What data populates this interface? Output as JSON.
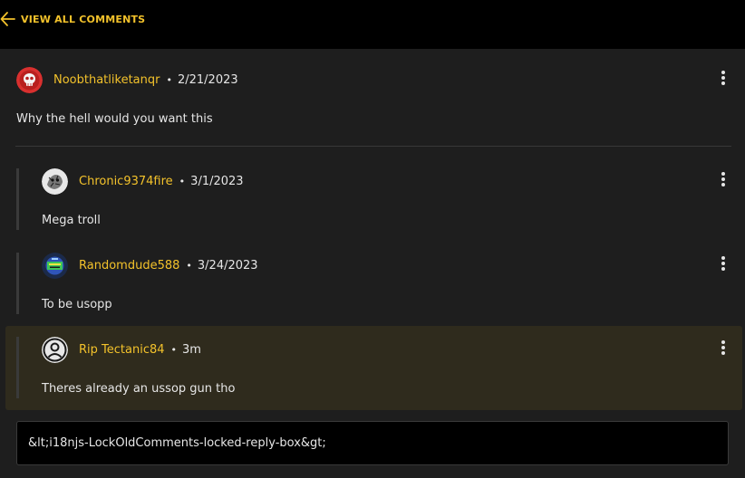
{
  "header": {
    "view_all_label": "VIEW ALL COMMENTS",
    "back_icon": "arrow-left-icon",
    "accent_color": "#f3c22b"
  },
  "comments": [
    {
      "username": "Noobthatliketanqr",
      "separator": "•",
      "date": "2/21/2023",
      "text": "Why the hell would you want this",
      "avatar_icon": "skull-avatar"
    },
    {
      "username": "Chronic9374fire",
      "separator": "•",
      "date": "3/1/2023",
      "text": "Mega troll",
      "avatar_icon": "sketch-avatar"
    },
    {
      "username": "Randomdude588",
      "separator": "•",
      "date": "3/24/2023",
      "text": "To be usopp",
      "avatar_icon": "badge-avatar"
    },
    {
      "username": "Rip Tectanic84",
      "separator": "•",
      "date": "3m",
      "text": "Theres already an ussop gun tho",
      "avatar_icon": "default-user-avatar",
      "highlighted": true
    }
  ],
  "reply_box": {
    "text": "&lt;i18njs-LockOldComments-locked-reply-box&gt;"
  },
  "menu_icon": "more-vertical-icon"
}
